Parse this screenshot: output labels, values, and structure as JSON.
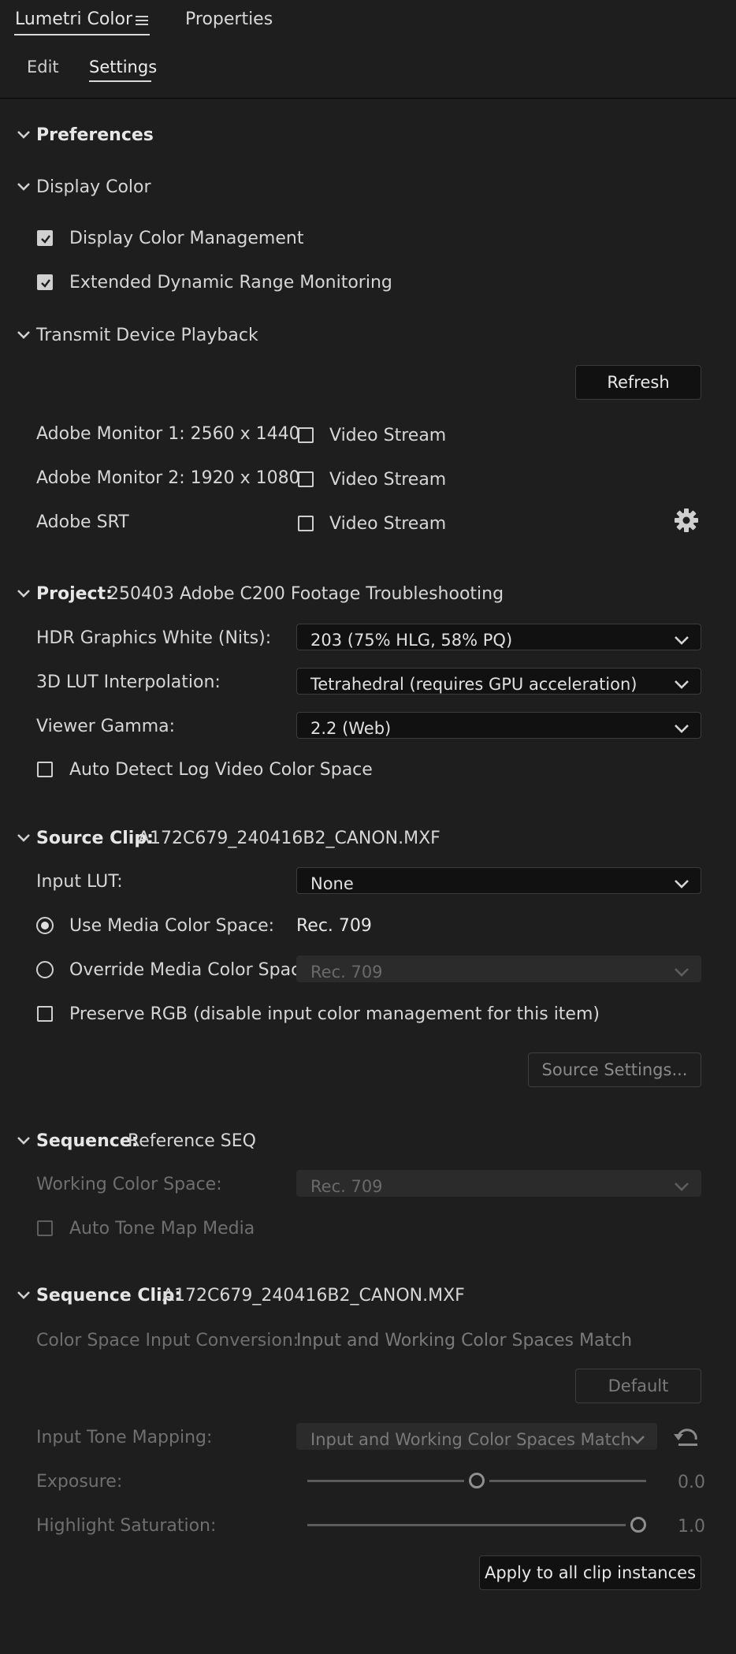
{
  "panel_tabs": {
    "lumetri": "Lumetri Color",
    "properties": "Properties"
  },
  "sub_tabs": {
    "edit": "Edit",
    "settings": "Settings"
  },
  "preferences": {
    "title": "Preferences"
  },
  "display_color": {
    "title": "Display Color",
    "display_color_management": "Display Color Management",
    "edr_monitoring": "Extended Dynamic Range Monitoring"
  },
  "transmit": {
    "title": "Transmit Device Playback",
    "refresh": "Refresh",
    "devices": [
      {
        "name": "Adobe Monitor 1: 2560 x 1440",
        "option": "Video Stream"
      },
      {
        "name": "Adobe Monitor 2: 1920 x 1080",
        "option": "Video Stream"
      },
      {
        "name": "Adobe SRT",
        "option": "Video Stream"
      }
    ]
  },
  "project": {
    "label": "Project:",
    "name": "250403 Adobe C200 Footage Troubleshooting",
    "hdr_white_label": "HDR Graphics White (Nits):",
    "hdr_white_value": "203 (75% HLG, 58% PQ)",
    "lut_interp_label": "3D LUT Interpolation:",
    "lut_interp_value": "Tetrahedral (requires GPU acceleration)",
    "viewer_gamma_label": "Viewer Gamma:",
    "viewer_gamma_value": "2.2 (Web)",
    "auto_detect_log": "Auto Detect Log Video Color Space"
  },
  "source_clip": {
    "label": "Source Clip:",
    "name": "A172C679_240416B2_CANON.MXF",
    "input_lut_label": "Input LUT:",
    "input_lut_value": "None",
    "use_media_label": "Use Media Color Space:",
    "use_media_value": "Rec. 709",
    "override_label": "Override Media Color Space:",
    "override_value": "Rec. 709",
    "preserve_rgb": "Preserve RGB (disable input color management for this item)",
    "source_settings": "Source Settings..."
  },
  "sequence": {
    "label": "Sequence:",
    "name": "Reference SEQ",
    "working_label": "Working Color Space:",
    "working_value": "Rec. 709",
    "auto_tone_map": "Auto Tone Map Media"
  },
  "sequence_clip": {
    "label": "Sequence Clip:",
    "name": "A172C679_240416B2_CANON.MXF",
    "csic_label": "Color Space Input Conversion:",
    "csic_value": "Input and Working Color Spaces Match",
    "default_btn": "Default",
    "tone_mapping_label": "Input Tone Mapping:",
    "tone_mapping_value": "Input and Working Color Spaces Match",
    "exposure_label": "Exposure:",
    "exposure_value": "0.0",
    "exposure_level": 0.5,
    "highlight_sat_label": "Highlight Saturation:",
    "highlight_sat_value": "1.0",
    "highlight_sat_level": 1.0,
    "apply_all": "Apply to all clip instances"
  }
}
